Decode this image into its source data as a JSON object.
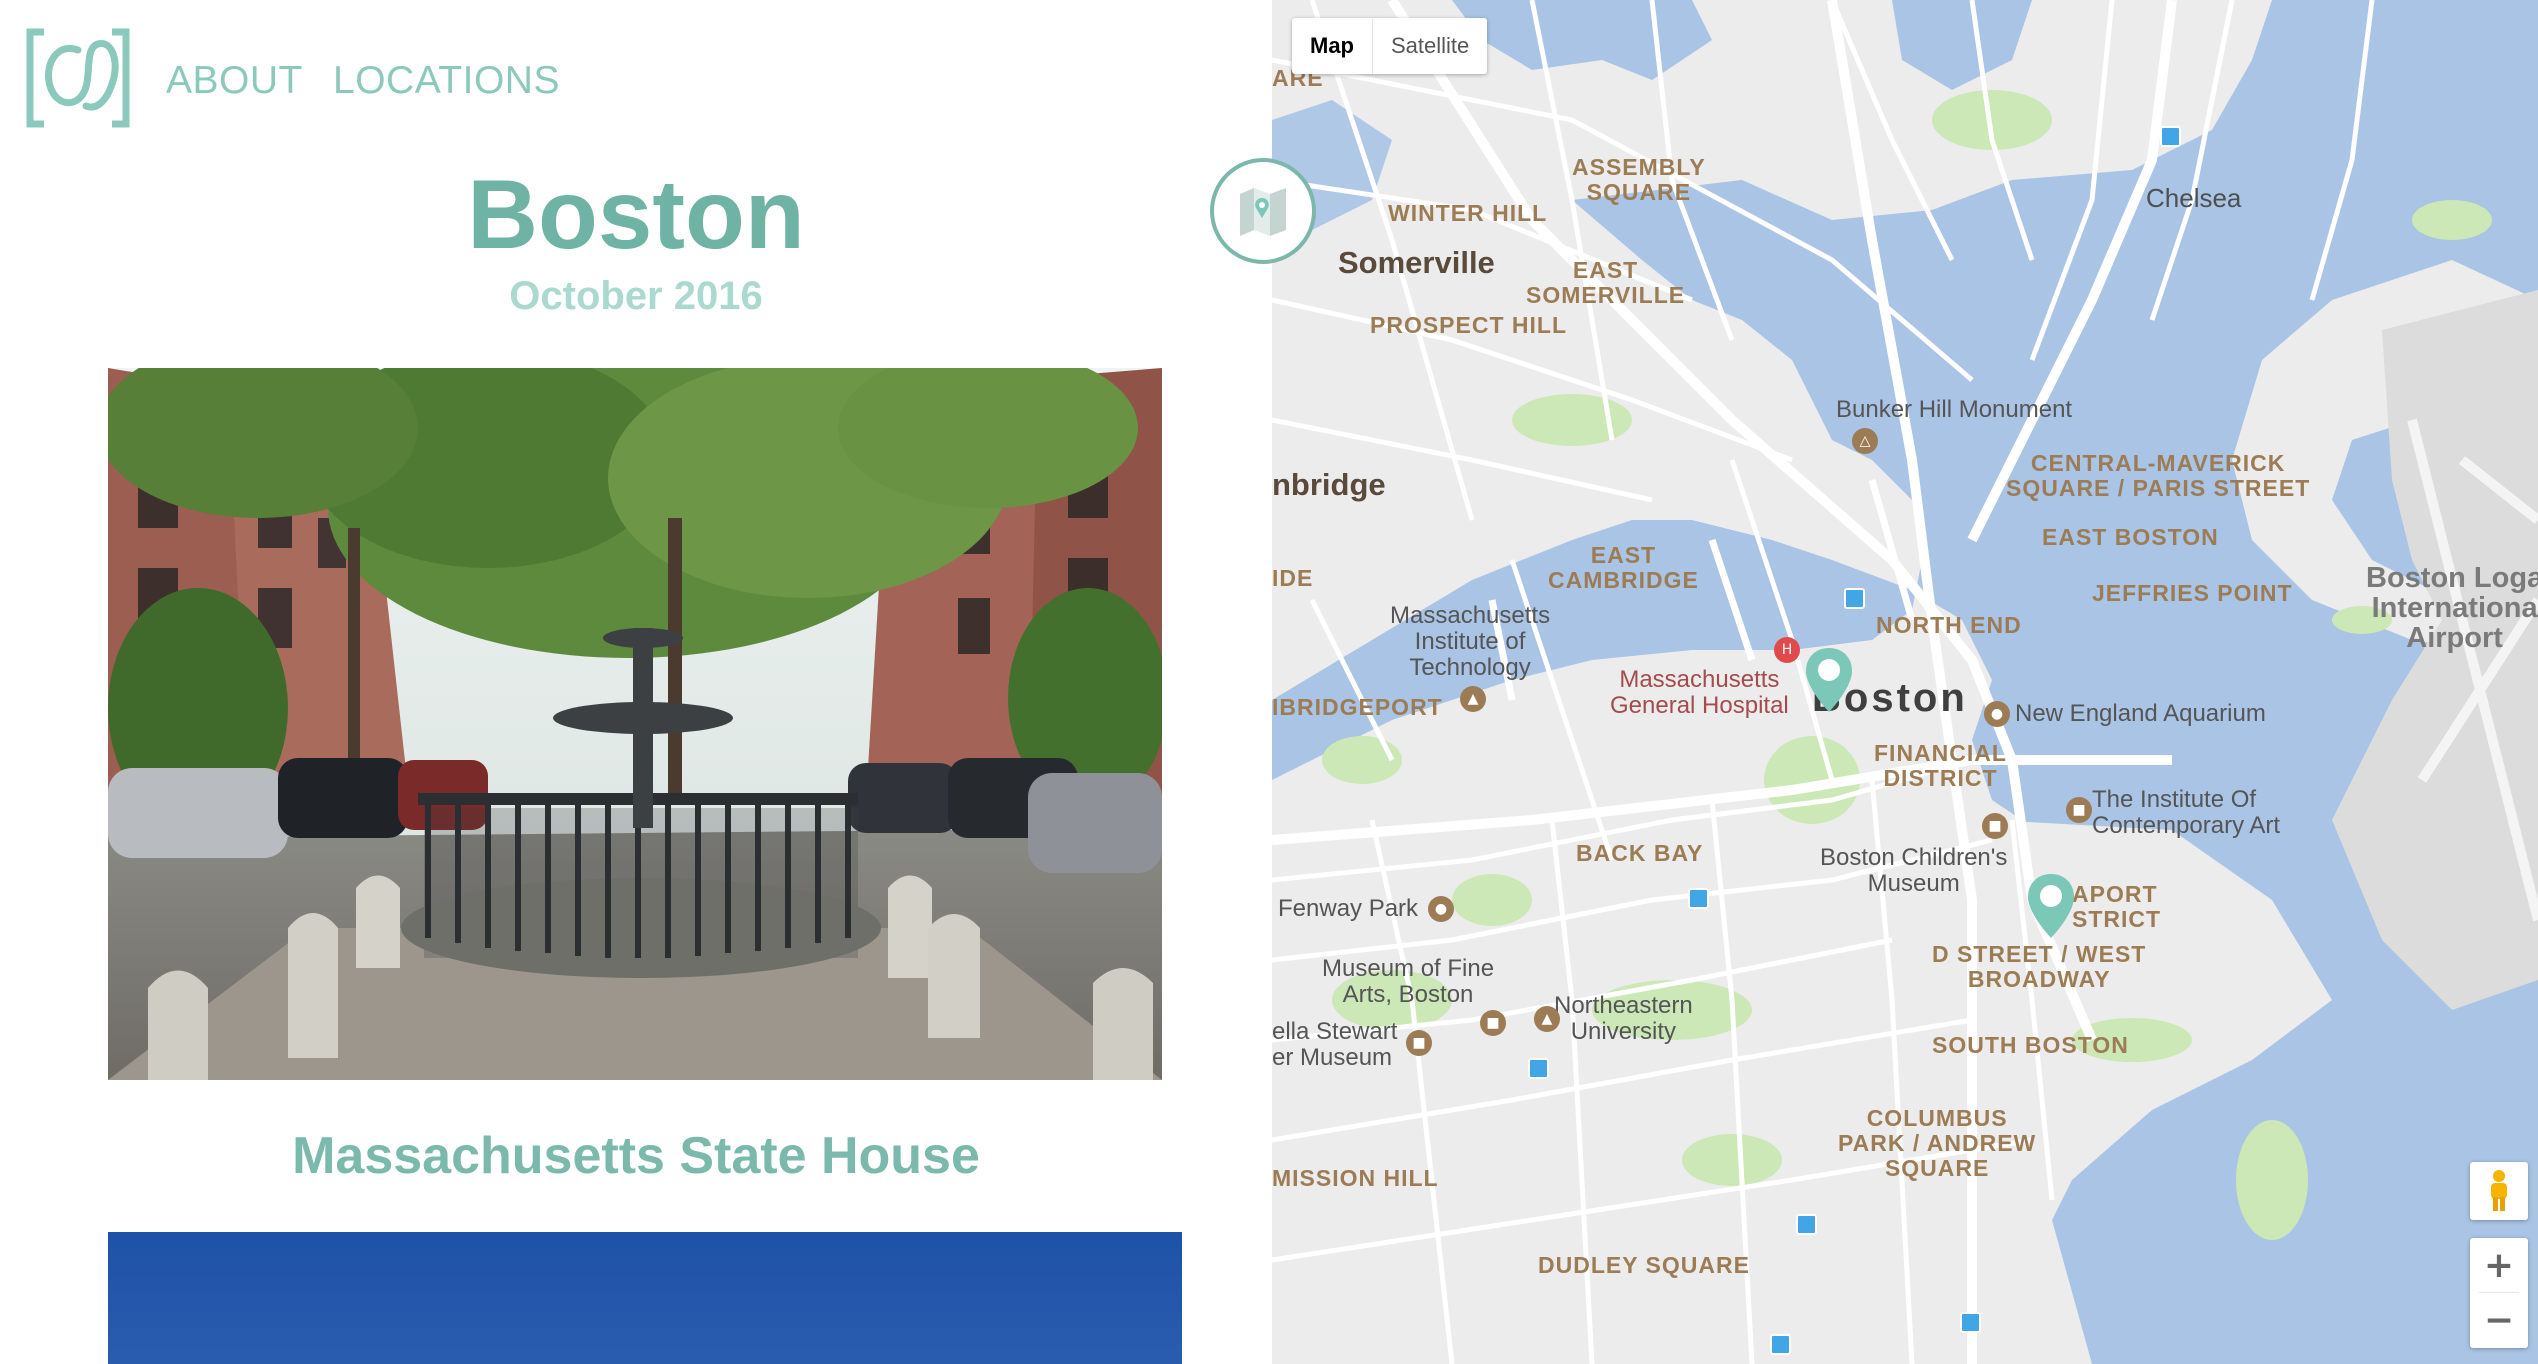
{
  "nav": {
    "about": "ABOUT",
    "locations": "LOCATIONS"
  },
  "page": {
    "title": "Boston",
    "date": "October 2016",
    "caption": "Massachusetts State House"
  },
  "map": {
    "type_controls": [
      "Map",
      "Satellite"
    ],
    "active_type": "Map",
    "labels": {
      "are": "ARE",
      "assembly_square": "ASSEMBLY\nSQUARE",
      "winter_hill": "WINTER HILL",
      "somerville": "Somerville",
      "east_somerville": "EAST\nSOMERVILLE",
      "prospect_hill": "PROSPECT HILL",
      "chelsea": "Chelsea",
      "bunker_hill": "Bunker Hill Monument",
      "central_maverick": "CENTRAL-MAVERICK\nSQUARE / PARIS STREET",
      "cambridge": "nbridge",
      "east_cambridge": "EAST\nCAMBRIDGE",
      "east_boston": "EAST BOSTON",
      "ide": "IDE",
      "jeffries_point": "JEFFRIES POINT",
      "mit": "Massachusetts\nInstitute of\nTechnology",
      "north_end": "NORTH END",
      "airport": "Boston Loga\nInternationa\nAirport",
      "mgh": "Massachusetts\nGeneral Hospital",
      "boston": "Boston",
      "aquarium": "New England Aquarium",
      "cambridgeport": "IBRIDGEPORT",
      "financial_district": "FINANCIAL\nDISTRICT",
      "ica": "The Institute Of\nContemporary Art",
      "back_bay": "BACK BAY",
      "childrens_museum": "Boston Children's\nMuseum",
      "seaport": "APORT\nSTRICT",
      "fenway": "Fenway Park",
      "d_street": "D STREET / WEST\nBROADWAY",
      "mfa": "Museum of Fine\nArts, Boston",
      "northeastern": "Northeastern\nUniversity",
      "gardner": "ella Stewart\ner Museum",
      "south_boston": "SOUTH BOSTON",
      "columbus_park": "COLUMBUS\nPARK / ANDREW\nSQUARE",
      "mission_hill": "MISSION HILL",
      "dudley_square": "DUDLEY SQUARE"
    },
    "icons": {
      "toggle": "folded-map-icon",
      "pegman": "street-view-pegman-icon",
      "zoom_in": "+",
      "zoom_out": "−"
    }
  },
  "colors": {
    "brand_teal": "#6fb3a5",
    "nav_teal": "#8bc9bd",
    "water": "#a9c4e5",
    "land": "#ececec",
    "park": "#cce8b6",
    "road": "#ffffff",
    "pin": "#7bc7b8"
  }
}
